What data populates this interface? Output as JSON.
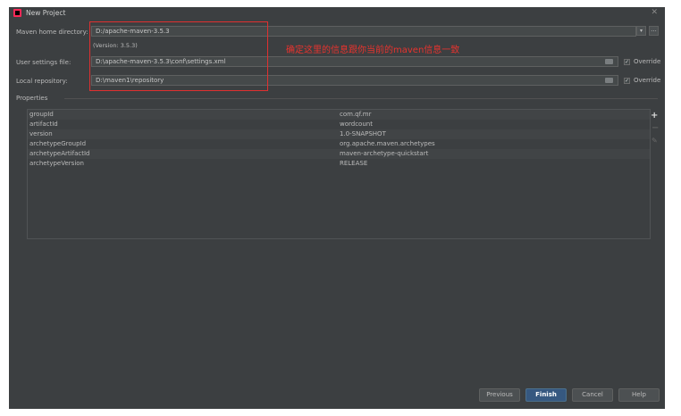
{
  "window": {
    "title": "New Project"
  },
  "maven": {
    "home_label": "Maven home directory:",
    "home_value": "D:/apache-maven-3.5.3",
    "version": "(Version: 3.5.3)",
    "settings_label": "User settings file:",
    "settings_value": "D:\\apache-maven-3.5.3\\conf\\settings.xml",
    "repo_label": "Local repository:",
    "repo_value": "D:\\maven1\\repository",
    "override_label": "Override"
  },
  "annotation": "确定这里的信息跟你当前的maven信息一致",
  "properties": {
    "title": "Properties",
    "rows": [
      {
        "key": "groupId",
        "value": "com.qf.mr"
      },
      {
        "key": "artifactId",
        "value": "wordcount"
      },
      {
        "key": "version",
        "value": "1.0-SNAPSHOT"
      },
      {
        "key": "archetypeGroupId",
        "value": "org.apache.maven.archetypes"
      },
      {
        "key": "archetypeArtifactId",
        "value": "maven-archetype-quickstart"
      },
      {
        "key": "archetypeVersion",
        "value": "RELEASE"
      }
    ]
  },
  "buttons": {
    "previous": "Previous",
    "finish": "Finish",
    "cancel": "Cancel",
    "help": "Help"
  },
  "colors": {
    "accent": "#365880",
    "annotation": "#e8332e",
    "background": "#3c3f41"
  }
}
